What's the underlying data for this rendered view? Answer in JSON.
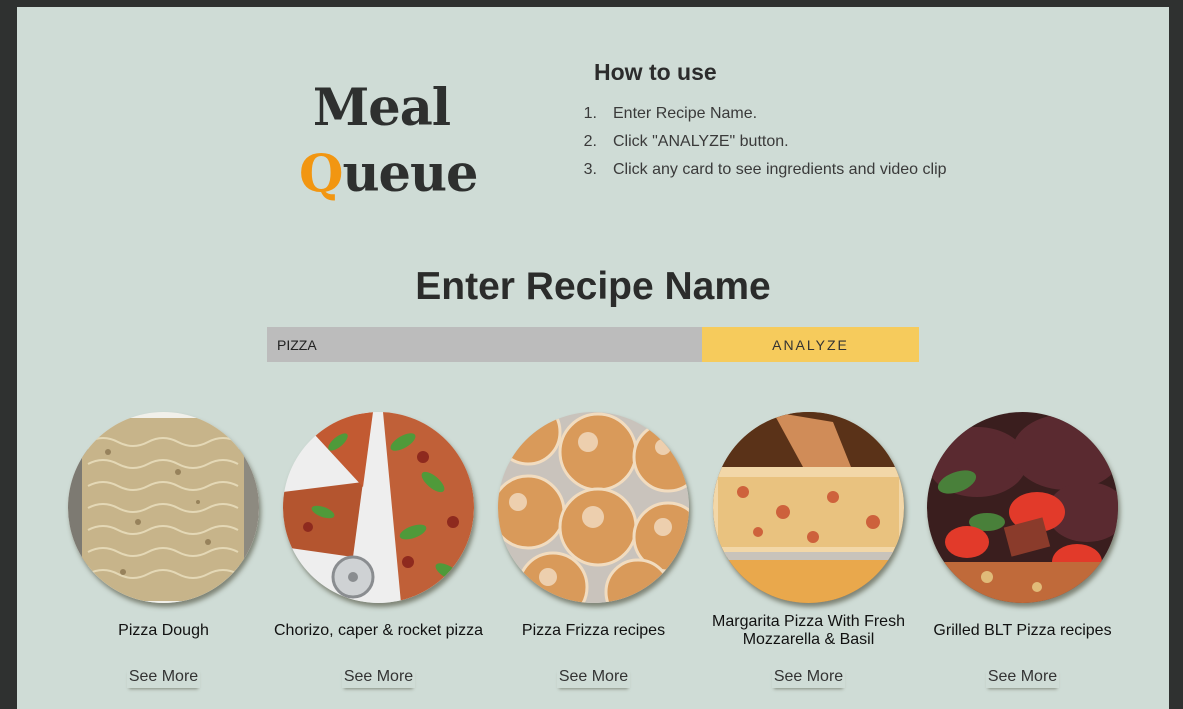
{
  "logo": {
    "line1": "Meal",
    "q_letter": "Q",
    "line2_rest": "ueue",
    "accent_color": "#f29611"
  },
  "how_to": {
    "title": "How to use",
    "steps": [
      {
        "num": "1.",
        "text": "Enter Recipe Name."
      },
      {
        "num": "2.",
        "text": "Click \"ANALYZE\" button."
      },
      {
        "num": "3.",
        "text": "Click any card to see ingredients and video clip"
      }
    ]
  },
  "search": {
    "title": "Enter Recipe Name",
    "value": "PIZZA",
    "button_label": "ANALYZE",
    "button_color": "#f6cb5c"
  },
  "cards": [
    {
      "title": "Pizza Dough",
      "more": "See More",
      "image": "pizza-dough-photo"
    },
    {
      "title": "Chorizo, caper & rocket pizza",
      "more": "See More",
      "image": "chorizo-pizza-photo"
    },
    {
      "title": "Pizza Frizza recipes",
      "more": "See More",
      "image": "pizza-frizza-photo"
    },
    {
      "title": "Margarita Pizza With Fresh Mozzarella & Basil",
      "more": "See More",
      "image": "margarita-pizza-photo"
    },
    {
      "title": "Grilled BLT Pizza recipes",
      "more": "See More",
      "image": "blt-pizza-photo"
    }
  ]
}
